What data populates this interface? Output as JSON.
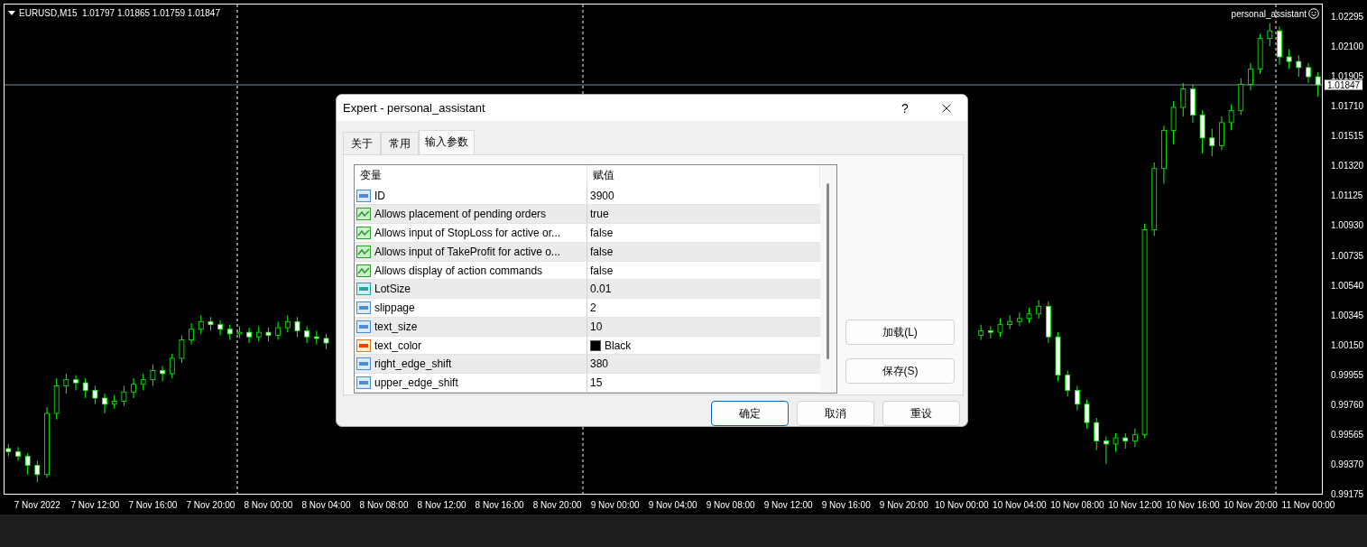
{
  "chart": {
    "symbol_info": "EURUSD,M15  1.01797 1.01865 1.01759 1.01847",
    "expert_label": "personal_assistant",
    "current_price": "1.01847",
    "chart_data": {
      "type": "candlestick",
      "ylim": [
        0.99169,
        1.02378
      ],
      "yticks": [
        {
          "value": 1.02295,
          "label": "1.02295"
        },
        {
          "value": 1.021,
          "label": "1.02100"
        },
        {
          "value": 1.01905,
          "label": "1.01905"
        },
        {
          "value": 1.0171,
          "label": "1.01710"
        },
        {
          "value": 1.01515,
          "label": "1.01515"
        },
        {
          "value": 1.0132,
          "label": "1.01320"
        },
        {
          "value": 1.01125,
          "label": "1.01125"
        },
        {
          "value": 1.0093,
          "label": "1.00930"
        },
        {
          "value": 1.00735,
          "label": "1.00735"
        },
        {
          "value": 1.0054,
          "label": "1.00540"
        },
        {
          "value": 1.00345,
          "label": "1.00345"
        },
        {
          "value": 1.0015,
          "label": "1.00150"
        },
        {
          "value": 0.99955,
          "label": "0.99955"
        },
        {
          "value": 0.9976,
          "label": "0.99760"
        },
        {
          "value": 0.99565,
          "label": "0.99565"
        },
        {
          "value": 0.9937,
          "label": "0.99370"
        },
        {
          "value": 0.99175,
          "label": "0.99175"
        }
      ],
      "ref_lines": [
        {
          "axis": "y",
          "value": 1.01847
        }
      ],
      "categories": [
        null,
        null,
        null,
        "7 Nov 2022",
        null,
        null,
        null,
        null,
        null,
        "7 Nov 12:00",
        null,
        null,
        null,
        null,
        null,
        "7 Nov 16:00",
        null,
        null,
        null,
        null,
        null,
        "7 Nov 20:00",
        null,
        null,
        null,
        null,
        null,
        "8 Nov 00:00",
        null,
        null,
        null,
        null,
        null,
        "8 Nov 04:00",
        null,
        null,
        null,
        null,
        null,
        "8 Nov 08:00",
        null,
        null,
        null,
        null,
        null,
        "8 Nov 12:00",
        null,
        null,
        null,
        null,
        null,
        "8 Nov 16:00",
        null,
        null,
        null,
        null,
        null,
        "8 Nov 20:00",
        null,
        null,
        null,
        null,
        null,
        "9 Nov 00:00",
        null,
        null,
        null,
        null,
        null,
        "9 Nov 04:00",
        null,
        null,
        null,
        null,
        null,
        "9 Nov 08:00",
        null,
        null,
        null,
        null,
        null,
        "9 Nov 12:00",
        null,
        null,
        null,
        null,
        null,
        "9 Nov 16:00",
        null,
        null,
        null,
        null,
        null,
        "9 Nov 20:00",
        null,
        null,
        null,
        null,
        null,
        "10 Nov 00:00",
        null,
        null,
        null,
        null,
        null,
        "10 Nov 04:00",
        null,
        null,
        null,
        null,
        null,
        "10 Nov 08:00",
        null,
        null,
        null,
        null,
        null,
        "10 Nov 12:00",
        null,
        null,
        null,
        null,
        null,
        "10 Nov 16:00",
        null,
        null,
        null,
        null,
        null,
        "10 Nov 20:00",
        null,
        null,
        null,
        null,
        null,
        "11 Nov 00:00",
        null
      ],
      "ohlc": [
        [
          0.9947,
          0.995,
          0.9942,
          0.9945
        ],
        [
          0.9945,
          0.9948,
          0.9939,
          0.9942
        ],
        [
          0.9942,
          0.9944,
          0.993,
          0.9936
        ],
        [
          0.9936,
          0.9939,
          0.9925,
          0.993
        ],
        [
          0.993,
          0.9974,
          0.9928,
          0.997
        ],
        [
          0.997,
          0.9993,
          0.9966,
          0.9988
        ],
        [
          0.9988,
          0.9996,
          0.9983,
          0.9992
        ],
        [
          0.9992,
          0.9995,
          0.9985,
          0.999
        ],
        [
          0.999,
          0.9993,
          0.998,
          0.9985
        ],
        [
          0.9985,
          0.9988,
          0.9976,
          0.998
        ],
        [
          0.998,
          0.9983,
          0.997,
          0.9976
        ],
        [
          0.9976,
          0.9982,
          0.9973,
          0.9978
        ],
        [
          0.9978,
          0.9988,
          0.9975,
          0.9984
        ],
        [
          0.9984,
          0.9993,
          0.998,
          0.9989
        ],
        [
          0.9989,
          0.9996,
          0.9985,
          0.9992
        ],
        [
          0.9992,
          1.0002,
          0.9988,
          0.9998
        ],
        [
          0.9998,
          1.0001,
          0.9991,
          0.9996
        ],
        [
          0.9996,
          1.0009,
          0.9993,
          1.0006
        ],
        [
          1.0006,
          1.0021,
          1.0003,
          1.0018
        ],
        [
          1.0018,
          1.0029,
          1.0015,
          1.0025
        ],
        [
          1.0025,
          1.0034,
          1.0022,
          1.003
        ],
        [
          1.003,
          1.0033,
          1.0024,
          1.0028
        ],
        [
          1.0028,
          1.0031,
          1.0021,
          1.0025
        ],
        [
          1.0025,
          1.0028,
          1.0018,
          1.0022
        ],
        [
          1.0022,
          1.0027,
          1.0019,
          1.0023
        ],
        [
          1.0023,
          1.0026,
          1.0016,
          1.002
        ],
        [
          1.002,
          1.0027,
          1.0017,
          1.0023
        ],
        [
          1.0023,
          1.0026,
          1.0017,
          1.0021
        ],
        [
          1.0021,
          1.003,
          1.0018,
          1.0026
        ],
        [
          1.0026,
          1.0034,
          1.0023,
          1.003
        ],
        [
          1.003,
          1.0033,
          1.002,
          1.0024
        ],
        [
          1.0024,
          1.0027,
          1.0016,
          1.002
        ],
        [
          1.002,
          1.0024,
          1.0015,
          1.0019
        ],
        [
          1.0019,
          1.0022,
          1.0012,
          1.0016
        ],
        null,
        null,
        null,
        null,
        null,
        null,
        null,
        null,
        null,
        null,
        null,
        null,
        null,
        null,
        null,
        null,
        null,
        null,
        null,
        null,
        null,
        null,
        null,
        null,
        null,
        null,
        null,
        null,
        null,
        null,
        null,
        null,
        null,
        null,
        null,
        null,
        null,
        null,
        null,
        null,
        null,
        null,
        null,
        null,
        null,
        null,
        null,
        null,
        null,
        null,
        null,
        null,
        null,
        null,
        null,
        null,
        null,
        null,
        null,
        null,
        null,
        null,
        null,
        null,
        null,
        null,
        null,
        [
          1.0021,
          1.0028,
          1.0018,
          1.0024
        ],
        [
          1.0024,
          1.0027,
          1.0019,
          1.0023
        ],
        [
          1.0023,
          1.0032,
          1.002,
          1.0028
        ],
        [
          1.0028,
          1.0034,
          1.0025,
          1.003
        ],
        [
          1.003,
          1.0036,
          1.0027,
          1.0032
        ],
        [
          1.0032,
          1.0039,
          1.0029,
          1.0035
        ],
        [
          1.0035,
          1.0044,
          1.0032,
          1.004
        ],
        [
          1.004,
          1.0043,
          1.0016,
          1.002
        ],
        [
          1.002,
          1.0023,
          0.9991,
          0.9995
        ],
        [
          0.9995,
          0.9998,
          0.9981,
          0.9985
        ],
        [
          0.9985,
          0.9988,
          0.9972,
          0.9976
        ],
        [
          0.9976,
          0.9979,
          0.996,
          0.9964
        ],
        [
          0.9964,
          0.9967,
          0.9946,
          0.9952
        ],
        [
          0.9952,
          0.9955,
          0.9937,
          0.995
        ],
        [
          0.995,
          0.9957,
          0.9945,
          0.9954
        ],
        [
          0.9954,
          0.9957,
          0.9947,
          0.9952
        ],
        [
          0.9952,
          0.996,
          0.9948,
          0.9956
        ],
        [
          0.9956,
          1.0094,
          0.9954,
          1.009
        ],
        [
          1.009,
          1.0134,
          1.0086,
          1.013
        ],
        [
          1.013,
          1.0158,
          1.012,
          1.0155
        ],
        [
          1.0155,
          1.0174,
          1.0146,
          1.017
        ],
        [
          1.017,
          1.0186,
          1.0164,
          1.0182
        ],
        [
          1.0182,
          1.0185,
          1.016,
          1.0165
        ],
        [
          1.0165,
          1.0168,
          1.014,
          1.015
        ],
        [
          1.015,
          1.0156,
          1.0138,
          1.0145
        ],
        [
          1.0145,
          1.0164,
          1.0142,
          1.016
        ],
        [
          1.016,
          1.0172,
          1.0155,
          1.0168
        ],
        [
          1.0168,
          1.0189,
          1.0165,
          1.0185
        ],
        [
          1.0185,
          1.0199,
          1.0181,
          1.0195
        ],
        [
          1.0195,
          1.0218,
          1.0192,
          1.0215
        ],
        [
          1.0215,
          1.0225,
          1.021,
          1.022
        ],
        [
          1.022,
          1.0223,
          1.0198,
          1.0203
        ],
        [
          1.0203,
          1.0208,
          1.0195,
          1.02
        ],
        [
          1.02,
          1.0204,
          1.019,
          1.0196
        ],
        [
          1.0196,
          1.0199,
          1.0186,
          1.019
        ],
        [
          1.019,
          1.0193,
          1.0177,
          1.01847
        ]
      ]
    }
  },
  "dialog": {
    "title": "Expert - personal_assistant",
    "help_button": "?",
    "tabs": [
      {
        "label": "关于",
        "selected": false
      },
      {
        "label": "常用",
        "selected": false
      },
      {
        "label": "输入参数",
        "selected": true
      }
    ],
    "table": {
      "columns": [
        "变量",
        "赋值"
      ],
      "rows": [
        {
          "kind": "int",
          "name": "ID",
          "value": "3900"
        },
        {
          "kind": "bool",
          "name": "Allows placement of pending orders",
          "value": "true"
        },
        {
          "kind": "bool",
          "name": "Allows input of StopLoss for active or...",
          "value": "false"
        },
        {
          "kind": "bool",
          "name": "Allows input of TakeProfit for active o...",
          "value": "false"
        },
        {
          "kind": "bool",
          "name": "Allows display of action commands",
          "value": "false"
        },
        {
          "kind": "double",
          "name": "LotSize",
          "value": "0.01"
        },
        {
          "kind": "int",
          "name": "slippage",
          "value": "2"
        },
        {
          "kind": "int",
          "name": "text_size",
          "value": "10"
        },
        {
          "kind": "color",
          "name": "text_color",
          "value": "Black",
          "color": "#000000"
        },
        {
          "kind": "int",
          "name": "right_edge_shift",
          "value": "380"
        },
        {
          "kind": "int",
          "name": "upper_edge_shift",
          "value": "15"
        }
      ]
    },
    "side_buttons": [
      "加载(L)",
      "保存(S)"
    ],
    "buttons": [
      {
        "label": "确定",
        "default": true
      },
      {
        "label": "取消",
        "default": false
      },
      {
        "label": "重设",
        "default": false
      }
    ]
  }
}
